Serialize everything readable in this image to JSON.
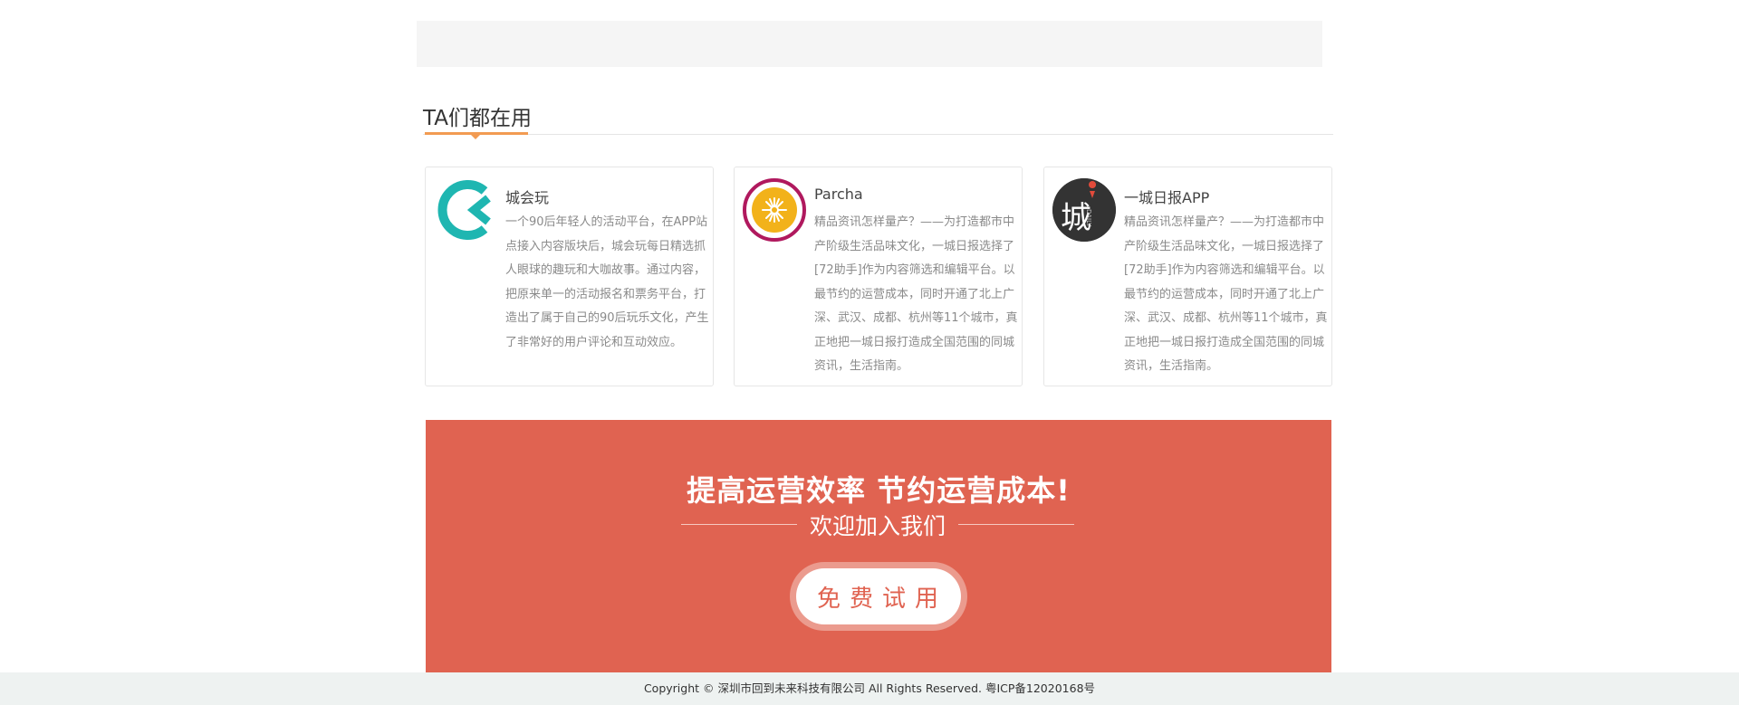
{
  "section": {
    "title": "TA们都在用"
  },
  "cards": [
    {
      "name": "城会玩",
      "description": "一个90后年轻人的活动平台，在APP站点接入内容版块后，城会玩每日精选抓人眼球的趣玩和大咖故事。通过内容，把原来单一的活动报名和票务平台，打造出了属于自己的90后玩乐文化，产生了非常好的用户评论和互动效应。",
      "logo_color": "#1fb6b1"
    },
    {
      "name": "Parcha",
      "description": "精品资讯怎样量产？——为打造都市中产阶级生活品味文化，一城日报选择了[72助手]作为内容筛选和编辑平台。以最节约的运营成本，同时开通了北上广深、武汉、成都、杭州等11个城市，真正地把一城日报打造成全国范围的同城资讯，生活指南。",
      "logo_ring_color": "#b0195e",
      "logo_fill_color": "#f2b21a"
    },
    {
      "name": "一城日报APP",
      "description": "精品资讯怎样量产？——为打造都市中产阶级生活品味文化，一城日报选择了[72助手]作为内容筛选和编辑平台。以最节约的运营成本，同时开通了北上广深、武汉、成都、杭州等11个城市，真正地把一城日报打造成全国范围的同城资讯，生活指南。",
      "logo_char": "城",
      "logo_small_text": "DAILY",
      "logo_bg": "#333333"
    }
  ],
  "cta": {
    "headline": "提高运营效率 节约运营成本!",
    "subline": "欢迎加入我们",
    "button_label": "免费试用",
    "bg_color": "#e06351"
  },
  "footer": {
    "text": "Copyright © 深圳市回到未来科技有限公司 All Rights Reserved. 粤ICP备12020168号"
  }
}
